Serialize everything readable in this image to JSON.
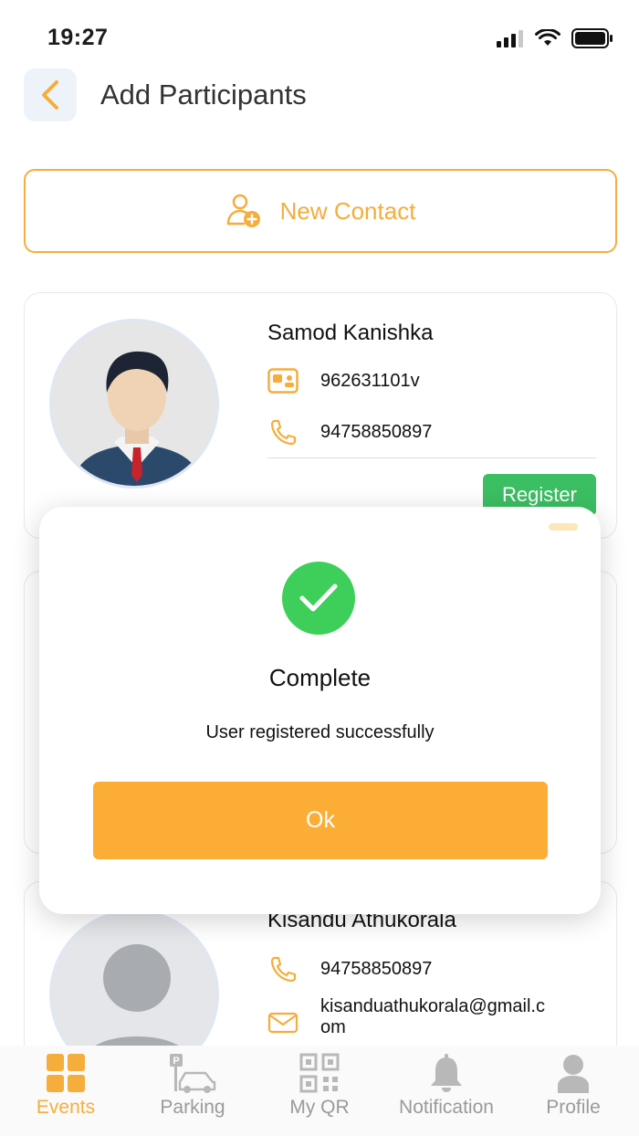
{
  "status_bar": {
    "time": "19:27"
  },
  "header": {
    "title": "Add Participants"
  },
  "new_contact": {
    "label": "New Contact"
  },
  "participants": [
    {
      "name": "Samod Kanishka",
      "id_number": "962631101v",
      "phone": "94758850897",
      "action": "Register"
    },
    {
      "name": "Kisandu Athukorala",
      "phone": "94758850897",
      "email_line1": "kisanduathukorala@gmail.c",
      "email_line2": "om"
    }
  ],
  "modal": {
    "title": "Complete",
    "message": "User registered successfully",
    "ok_label": "Ok"
  },
  "bottom_nav": {
    "items": [
      {
        "label": "Events",
        "icon": "grid-icon",
        "active": true
      },
      {
        "label": "Parking",
        "icon": "car-parking-icon",
        "active": false
      },
      {
        "label": "My QR",
        "icon": "qr-code-icon",
        "active": false
      },
      {
        "label": "Notification",
        "icon": "bell-icon",
        "active": false
      },
      {
        "label": "Profile",
        "icon": "person-icon",
        "active": false
      }
    ]
  },
  "colors": {
    "accent": "#f5ad3b",
    "success": "#3ecf5a",
    "register": "#3cbf63"
  }
}
